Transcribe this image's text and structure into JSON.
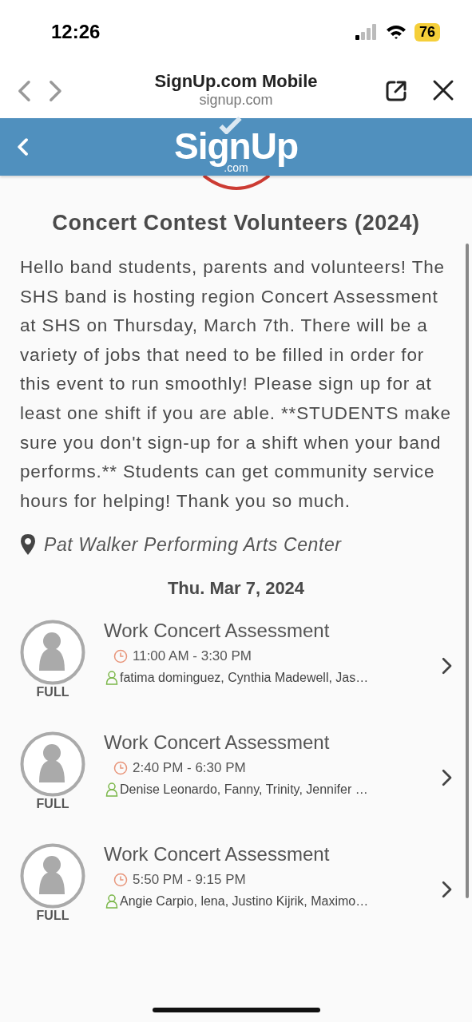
{
  "status_bar": {
    "time": "12:26",
    "battery": "76"
  },
  "browser": {
    "title": "SignUp.com Mobile",
    "address": "signup.com"
  },
  "header": {
    "logo": "SignUp",
    "logo_suffix": ".com"
  },
  "signup": {
    "title": "Concert Contest Volunteers (2024)",
    "description": "Hello band students, parents and volunteers! The SHS band is hosting region Concert Assessment at SHS on Thursday, March 7th. There will be a variety of jobs that need to be filled in order for this event to run smoothly! Please sign up for at least one shift if you are able. **STUDENTS make sure you don't sign-up for a shift when your band performs.** Students can get community service hours for helping! Thank you so much.",
    "location": "Pat Walker Performing Arts Center",
    "date": "Thu. Mar 7, 2024",
    "slots": [
      {
        "title": "Work Concert Assessment",
        "time": "11:00 AM - 3:30 PM",
        "people": "fatima dominguez, Cynthia Madewell, Jas…",
        "status": "FULL"
      },
      {
        "title": "Work Concert Assessment",
        "time": "2:40 PM - 6:30 PM",
        "people": "Denise Leonardo, Fanny, Trinity, Jennifer …",
        "status": "FULL"
      },
      {
        "title": "Work Concert Assessment",
        "time": "5:50 PM - 9:15 PM",
        "people": "Angie Carpio, lena, Justino Kijrik, Maximo…",
        "status": "FULL"
      }
    ]
  }
}
